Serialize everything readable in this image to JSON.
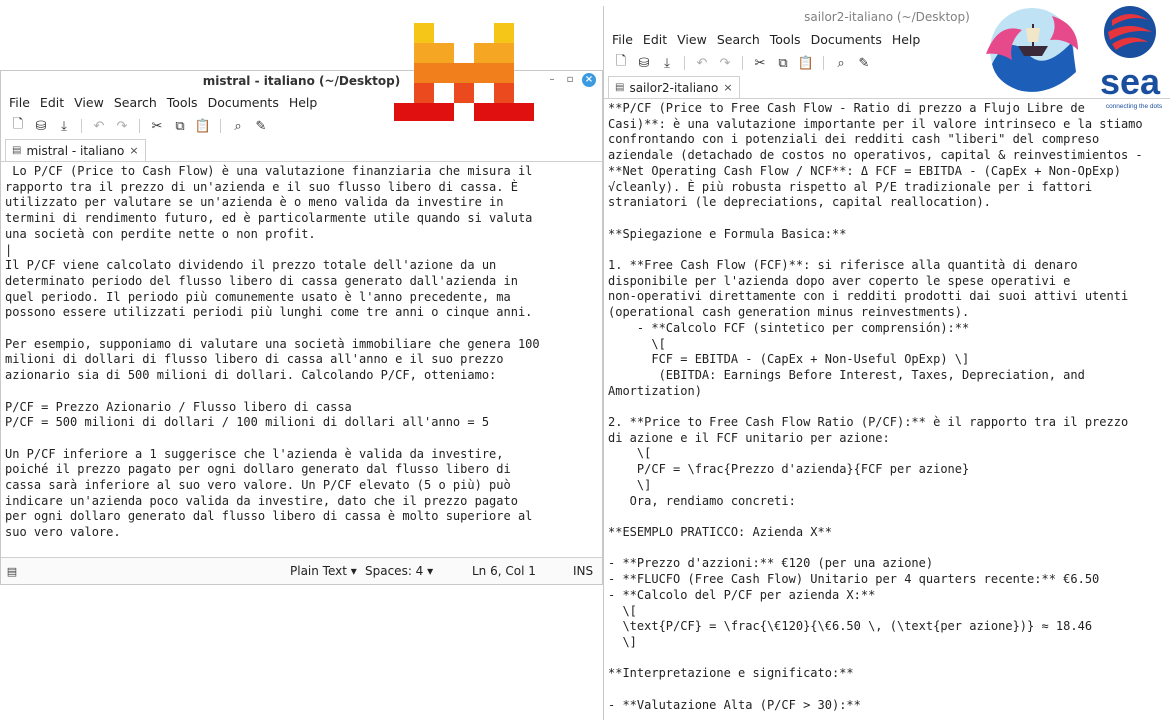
{
  "left_window": {
    "title": "mistral - italiano (~/Desktop)",
    "menu": [
      "File",
      "Edit",
      "View",
      "Search",
      "Tools",
      "Documents",
      "Help"
    ],
    "tab_label": "mistral - italiano",
    "text": " Lo P/CF (Price to Cash Flow) è una valutazione finanziaria che misura il\nrapporto tra il prezzo di un'azienda e il suo flusso libero di cassa. È\nutilizzato per valutare se un'azienda è o meno valida da investire in\ntermini di rendimento futuro, ed è particolarmente utile quando si valuta\nuna società con perdite nette o non profit.\n|\nIl P/CF viene calcolato dividendo il prezzo totale dell'azione da un\ndeterminato periodo del flusso libero di cassa generato dall'azienda in\nquel periodo. Il periodo più comunemente usato è l'anno precedente, ma\npossono essere utilizzati periodi più lunghi come tre anni o cinque anni.\n\nPer esempio, supponiamo di valutare una società immobiliare che genera 100\nmilioni di dollari di flusso libero di cassa all'anno e il suo prezzo\nazionario sia di 500 milioni di dollari. Calcolando P/CF, otteniamo:\n\nP/CF = Prezzo Azionario / Flusso libero di cassa\nP/CF = 500 milioni di dollari / 100 milioni di dollari all'anno = 5\n\nUn P/CF inferiore a 1 suggerisce che l'azienda è valida da investire,\npoiché il prezzo pagato per ogni dollaro generato dal flusso libero di\ncassa sarà inferiore al suo vero valore. Un P/CF elevato (5 o più) può\nindicare un'azienda poco valida da investire, dato che il prezzo pagato\nper ogni dollaro generato dal flusso libero di cassa è molto superiore al\nsuo vero valore.",
    "status": {
      "language": "Plain Text ▾",
      "spaces": "Spaces: 4 ▾",
      "position": "Ln 6, Col 1",
      "mode": "INS"
    }
  },
  "right_window": {
    "title": "sailor2-italiano (~/Desktop)",
    "menu": [
      "File",
      "Edit",
      "View",
      "Search",
      "Tools",
      "Documents",
      "Help"
    ],
    "tab_label": "sailor2-italiano",
    "text": "**P/CF (Price to Free Cash Flow - Ratio di prezzo a Flujo Libre de\nCasi)**: è una valutazione importante per il valore intrinseco e la stiamo\nconfrontando con i potenziali dei redditi cash \"liberi\" del compreso\naziendale (detachado de costos no operativos, capital & reinvestimientos -\n**Net Operating Cash Flow / NCF**: Δ FCF = EBITDA - (CapEx + Non-OpExp)\n√cleanly). È più robusta rispetto al P/E tradizionale per i fattori\nstraniatori (le depreciations, capital reallocation).\n\n**Spiegazione e Formula Basica:**\n\n1. **Free Cash Flow (FCF)**: si riferisce alla quantità di denaro\ndisponibile per l'azienda dopo aver coperto le spese operativi e\nnon-operativi direttamente con i redditi prodotti dai suoi attivi utenti\n(operational cash generation minus reinvestments).\n    - **Calcolo FCF (sintetico per comprensión):**\n      \\[\n      FCF = EBITDA - (CapEx + Non-Useful OpExp) \\]\n       (EBITDA: Earnings Before Interest, Taxes, Depreciation, and\nAmortization)\n\n2. **Price to Free Cash Flow Ratio (P/CF):** è il rapporto tra il prezzo\ndi azione e il FCF unitario per azione:\n    \\[\n    P/CF = \\frac{Prezzo d'azienda}{FCF per azione}\n    \\]\n   Ora, rendiamo concreti:\n\n**ESEMPLO PRATICCO: Azienda X**\n\n- **Prezzo d'azzioni:** €120 (per una azione)\n- **FLUCFO (Free Cash Flow) Unitario per 4 quarters recente:** €6.50\n- **Calcolo del P/CF per azienda X:**\n  \\[\n  \\text{P/CF} = \\frac{\\€120}{\\€6.50 \\, (\\text{per azione})} ≈ 18.46\n  \\]\n\n**Interpretazione e significato:**\n\n- **Valutazione Alta (P/CF > 30):**"
  },
  "sea_logo": {
    "word": "sea",
    "tagline": "connecting the dots"
  },
  "colors": {
    "pixel_logo": [
      "#f5c518",
      "#f5a623",
      "#f07f1c",
      "#ea4a1e",
      "#e01010"
    ],
    "sea_blue": "#1a4fa0",
    "sea_red": "#e8343b",
    "wm_close": "#3a9be0"
  }
}
